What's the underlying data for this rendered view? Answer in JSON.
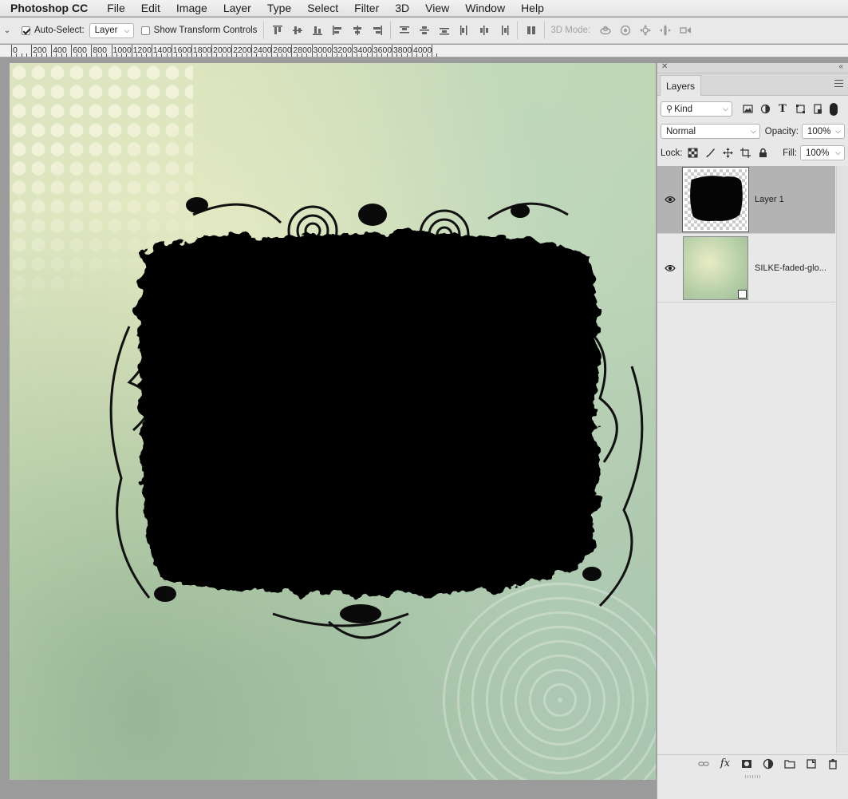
{
  "app": {
    "name": "Photoshop CC",
    "menus": [
      "File",
      "Edit",
      "Image",
      "Layer",
      "Type",
      "Select",
      "Filter",
      "3D",
      "View",
      "Window",
      "Help"
    ]
  },
  "options_bar": {
    "auto_select_label": "Auto-Select:",
    "auto_select_checked": true,
    "auto_select_value": "Layer",
    "transform_controls_label": "Show Transform Controls",
    "transform_controls_checked": false,
    "mode_3d_label": "3D Mode:"
  },
  "ruler": {
    "labels": [
      "0",
      "200",
      "400",
      "600",
      "800",
      "1000",
      "1200",
      "1400",
      "1600",
      "1800",
      "2000",
      "2200",
      "2400",
      "2600",
      "2800",
      "3000",
      "3200",
      "3400",
      "3600",
      "3800",
      "4000"
    ]
  },
  "layers_panel": {
    "tab_label": "Layers",
    "filter_label": "Kind",
    "blend_mode": "Normal",
    "opacity_label": "Opacity:",
    "opacity_value": "100%",
    "lock_label": "Lock:",
    "fill_label": "Fill:",
    "fill_value": "100%",
    "layers": [
      {
        "name": "Layer 1",
        "visible": true,
        "selected": true
      },
      {
        "name": "SILKE-faded-glo...",
        "visible": true,
        "selected": false
      }
    ]
  },
  "colors": {
    "selected_layer_bg": "#b3b3b3",
    "panel_bg": "#e8e8e8",
    "workspace_bg": "#9b9b9b"
  }
}
